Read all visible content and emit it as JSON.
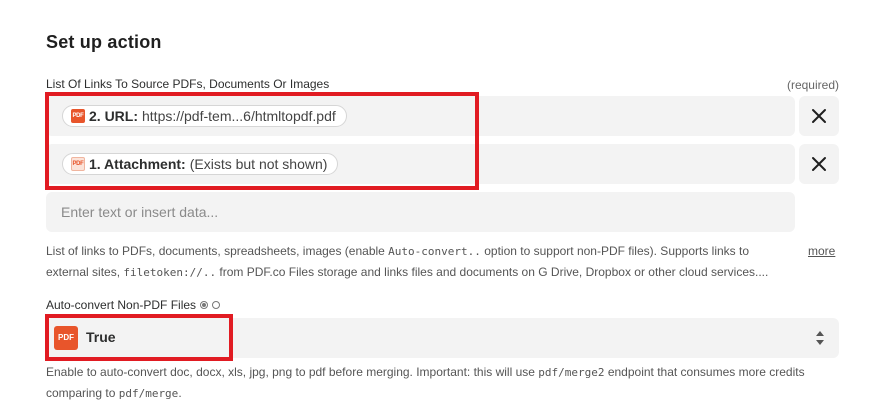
{
  "section": {
    "title": "Set up action"
  },
  "links_field": {
    "label": "List Of Links To Source PDFs, Documents Or Images",
    "required": "(required)",
    "items": [
      {
        "icon": "PDF",
        "label": "2. URL:",
        "value": "https://pdf-tem...6/htmltopdf.pdf"
      },
      {
        "icon": "PDF",
        "label": "1. Attachment:",
        "value": "(Exists but not shown)"
      }
    ],
    "placeholder": "Enter text or insert data...",
    "help_parts": [
      "List of links to PDFs, documents, spreadsheets, images (enable ",
      "Auto-convert..",
      " option to support non-PDF files). Supports links to external sites, ",
      "filetoken://..",
      " from PDF.co Files storage and links files and documents on G Drive, Dropbox or other cloud services...."
    ],
    "more": "more"
  },
  "autoconvert_field": {
    "label": "Auto-convert Non-PDF Files",
    "icon": "PDF",
    "value": "True",
    "help_parts": [
      "Enable to auto-convert doc, docx, xls, jpg, png to pdf before merging. Important: this will use ",
      "pdf/merge2",
      " endpoint that consumes more credits comparing to ",
      "pdf/merge",
      "."
    ]
  },
  "colors": {
    "highlight": "#e11b22",
    "brand": "#e8552b"
  }
}
